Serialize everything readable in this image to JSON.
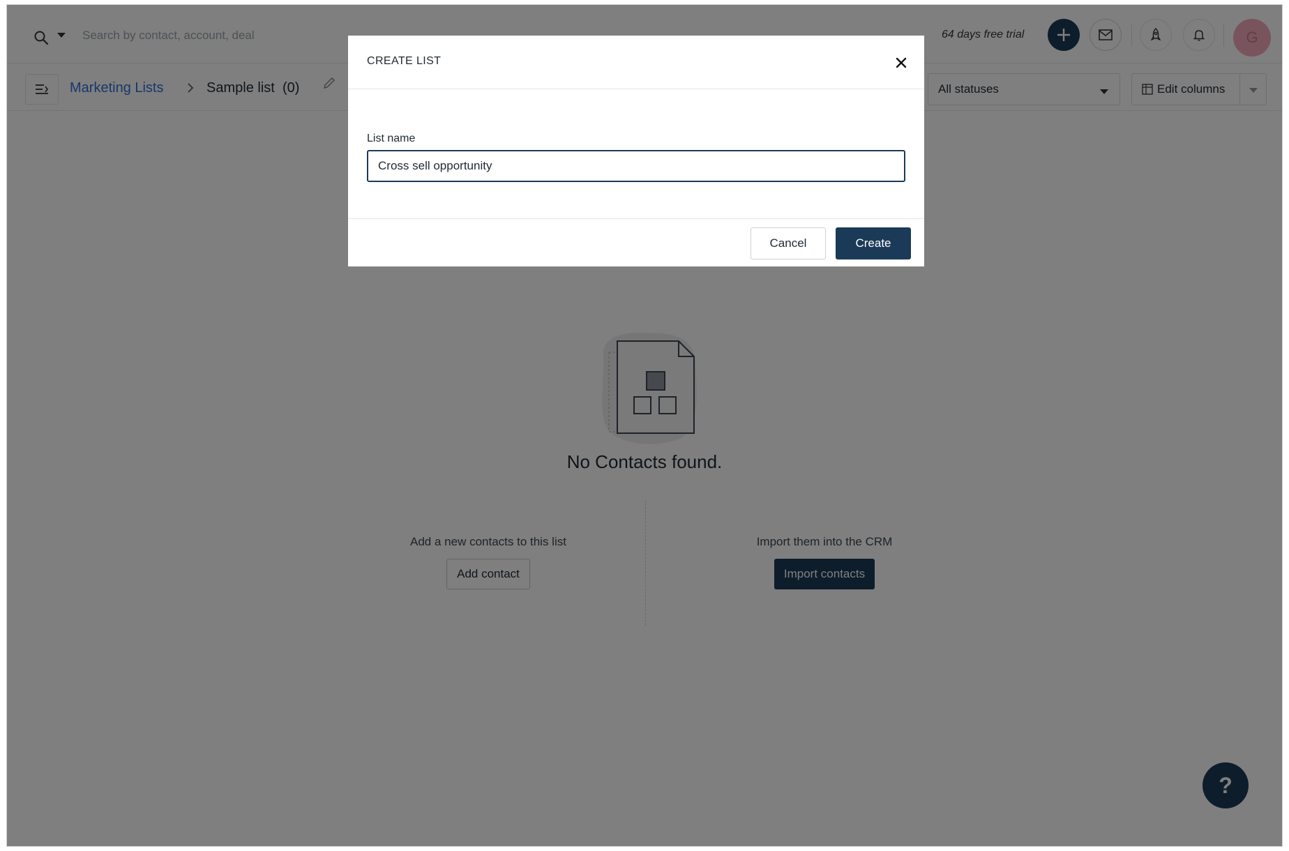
{
  "header": {
    "search_placeholder": "Search by contact, account, deal",
    "trial_text": "64 days free trial",
    "avatar_initial": "G"
  },
  "breadcrumb": {
    "parent": "Marketing Lists",
    "current": "Sample list",
    "count": "(0)"
  },
  "toolbar": {
    "status_filter": "All statuses",
    "edit_columns_label": "Edit columns"
  },
  "empty_state": {
    "title": "No Contacts found.",
    "left_text": "Add a new contacts to this list",
    "left_button": "Add contact",
    "right_text": "Import them into the CRM",
    "right_button": "Import contacts"
  },
  "help": {
    "label": "?"
  },
  "modal": {
    "title": "CREATE LIST",
    "field_label": "List name",
    "field_value": "Cross sell opportunity",
    "cancel_label": "Cancel",
    "create_label": "Create"
  },
  "colors": {
    "primary": "#1b3a57",
    "link": "#2f6fd8",
    "avatar": "#f4a8b8",
    "overlay": "rgba(0,0,0,0.5)"
  }
}
